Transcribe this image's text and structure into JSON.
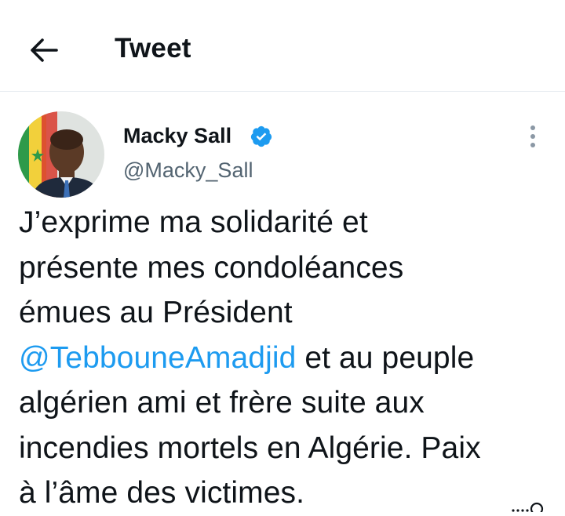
{
  "header": {
    "title": "Tweet",
    "back_icon": "arrow-left-icon"
  },
  "author": {
    "name": "Macky Sall",
    "handle": "@Macky_Sall",
    "verified": true,
    "verified_color": "#1d9bf0"
  },
  "tweet": {
    "line1": "J’exprime ma solidarité et",
    "line2": "présente mes condoléances",
    "line3": "émues au Président",
    "mention": "@TebbouneAmadjid",
    "line4_rest": " et au peuple",
    "line5": "algérien ami et frère suite aux",
    "line6": "incendies mortels en Algérie. Paix",
    "line7": "à l’âme des victimes."
  },
  "colors": {
    "accent": "#1d9bf0",
    "secondary_text": "#536471",
    "primary_text": "#0f1419"
  }
}
